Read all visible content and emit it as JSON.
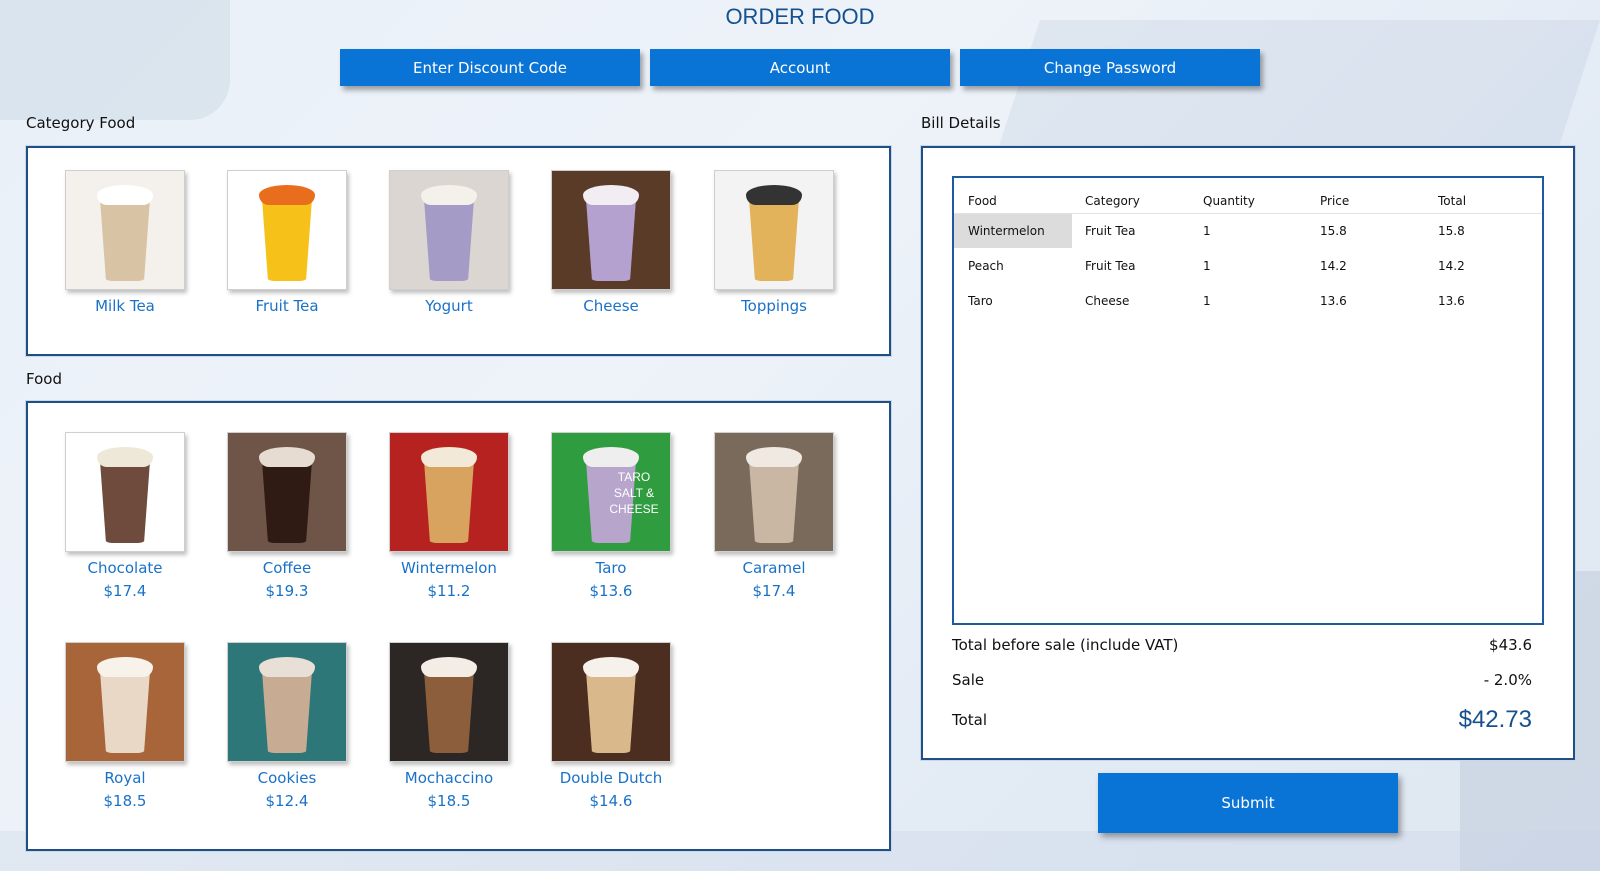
{
  "header": {
    "title": "ORDER FOOD",
    "buttons": {
      "discount": "Enter Discount Code",
      "account": "Account",
      "change_password": "Change Password"
    }
  },
  "category_section": {
    "label": "Category Food",
    "items": [
      {
        "name": "Milk Tea",
        "bg": "#f4f1ec",
        "drink": "#d8c3a5",
        "top": "#ffffff"
      },
      {
        "name": "Fruit Tea",
        "bg": "#ffffff",
        "drink": "#f6c21a",
        "top": "#e86d1c"
      },
      {
        "name": "Yogurt",
        "bg": "#dcd6d2",
        "drink": "#a49bc7",
        "top": "#f4f0ea"
      },
      {
        "name": "Cheese",
        "bg": "#5a3b28",
        "drink": "#b5a1cf",
        "top": "#f1edf3"
      },
      {
        "name": "Toppings",
        "bg": "#f3f3f3",
        "drink": "#e3b35b",
        "top": "#333333"
      }
    ]
  },
  "food_section": {
    "label": "Food",
    "items": [
      {
        "name": "Chocolate",
        "price": "$17.4",
        "bg": "#ffffff",
        "drink": "#6e4b3c",
        "top": "#eee8d8"
      },
      {
        "name": "Coffee",
        "price": "$19.3",
        "bg": "#6f5448",
        "drink": "#2f1b14",
        "top": "#e7dcd1"
      },
      {
        "name": "Wintermelon",
        "price": "$11.2",
        "bg": "#b62220",
        "drink": "#d8a25f",
        "top": "#f3e9d8"
      },
      {
        "name": "Taro",
        "price": "$13.6",
        "bg": "#2f9d3f",
        "drink": "#b7a5cc",
        "top": "#eeeeee",
        "overlay": "TARO SALT & CHEESE"
      },
      {
        "name": "Caramel",
        "price": "$17.4",
        "bg": "#7a6a5b",
        "drink": "#c9b6a3",
        "top": "#efe9e1"
      },
      {
        "name": "Royal",
        "price": "$18.5",
        "bg": "#a8653a",
        "drink": "#ead8c6",
        "top": "#f7f3ea"
      },
      {
        "name": "Cookies",
        "price": "$12.4",
        "bg": "#2e7778",
        "drink": "#c8ab93",
        "top": "#e8e0d6"
      },
      {
        "name": "Mochaccino",
        "price": "$18.5",
        "bg": "#2c2624",
        "drink": "#8c5e3b",
        "top": "#f3ede5"
      },
      {
        "name": "Double Dutch",
        "price": "$14.6",
        "bg": "#4b2e1f",
        "drink": "#d9b98b",
        "top": "#f6f1ea"
      }
    ]
  },
  "bill": {
    "label": "Bill Details",
    "columns": [
      "Food",
      "Category",
      "Quantity",
      "Price",
      "Total"
    ],
    "rows": [
      {
        "food": "Wintermelon",
        "category": "Fruit Tea",
        "quantity": "1",
        "price": "15.8",
        "total": "15.8"
      },
      {
        "food": "Peach",
        "category": "Fruit Tea",
        "quantity": "1",
        "price": "14.2",
        "total": "14.2"
      },
      {
        "food": "Taro",
        "category": "Cheese",
        "quantity": "1",
        "price": "13.6",
        "total": "13.6"
      }
    ],
    "summary": {
      "before_sale_label": "Total before sale (include VAT)",
      "before_sale_value": "$43.6",
      "sale_label": "Sale",
      "sale_value": "- 2.0%",
      "total_label": "Total",
      "total_value": "$42.73"
    }
  },
  "submit_label": "Submit"
}
